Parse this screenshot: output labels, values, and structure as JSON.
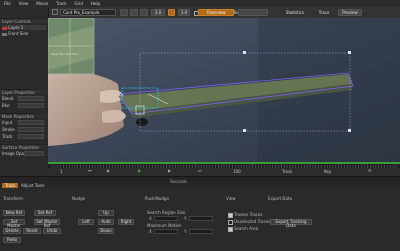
{
  "menu": [
    "File",
    "View",
    "Movie",
    "Track",
    "Grid",
    "Help"
  ],
  "toolbar": {
    "clip_name": "Card Pro_Example",
    "clip_size": "3.0",
    "zoom": "3.0",
    "show_transform_tool": "Show Transform Tool",
    "overview_label": "Overview",
    "statistics_label": "Statistics",
    "trace_label": "Trace",
    "preview_label": "Preview"
  },
  "left_panel": {
    "title": "Layer Controls",
    "layers": [
      "Layer 1",
      "Front Side"
    ],
    "sections": [
      "Layer Properties",
      "Mask Properties",
      "Surface Properties"
    ],
    "fields": [
      "Blend",
      "Blur",
      "Input",
      "Stroke",
      "Track",
      "Image Opacity"
    ]
  },
  "viewer": {
    "magnifier_label": "Magnifier Window",
    "image": "hand holding card"
  },
  "timeline": {
    "frames": [
      "1",
      "10",
      "20",
      "30",
      "40",
      "50",
      "60",
      "70",
      "80",
      "90",
      "100",
      "110",
      "120"
    ],
    "current_frame": "1",
    "end_frame": "100",
    "track_label": "Track",
    "key_label": "Key",
    "time_label": "Seconds"
  },
  "dock_tabs": [
    "Track",
    "Adjust Tools"
  ],
  "bottom": {
    "transform": {
      "title": "Transform",
      "buttons": [
        "New Ref",
        "Set Ref",
        "Set Master",
        "Set Master Ref",
        "Delete",
        "Reset",
        "Undo",
        "Redo"
      ]
    },
    "nudge": {
      "title": "Nudge",
      "buttons": [
        "Up",
        "Left",
        "Auto",
        "Right",
        "Down"
      ]
    },
    "push_nudge": {
      "title": "Push/Nudge",
      "search_region_size": "Search Region Size",
      "max_motion": "Maximum Motion",
      "x_label": "X",
      "y_label": "Y",
      "x_val": "5",
      "y_val": "5",
      "mx_val": "10",
      "my_val": "10"
    },
    "view": {
      "title": "View",
      "options": [
        "Tracker Traces",
        "Unselected Traces",
        "Search Area"
      ]
    },
    "export": {
      "title": "Export Data",
      "button": "Export Tracking Data"
    }
  },
  "colors": {
    "accent_orange": "#b06a1c",
    "panel_bg": "#2a2a2a",
    "tracker_cyan": "#22c8ff",
    "spline_purple": "#7f5cff",
    "play_green": "#3fbf3f"
  }
}
